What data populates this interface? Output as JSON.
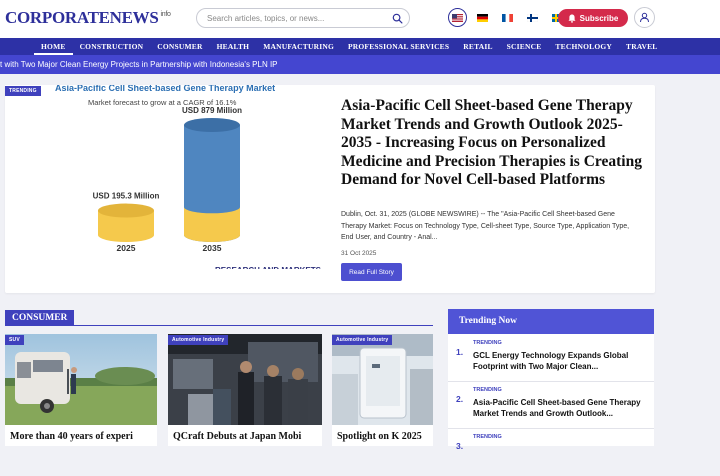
{
  "header": {
    "logo_main": "CORPORATENEWS",
    "logo_tld": "info",
    "search_placeholder": "Search articles, topics, or news...",
    "subscribe_label": "Subscribe",
    "flags": [
      "us",
      "de",
      "fr",
      "fi",
      "se"
    ]
  },
  "nav": {
    "items": [
      "HOME",
      "CONSTRUCTION",
      "CONSUMER",
      "HEALTH",
      "MANUFACTURING",
      "PROFESSIONAL SERVICES",
      "RETAIL",
      "SCIENCE",
      "TECHNOLOGY",
      "TRAVEL"
    ],
    "active": "HOME"
  },
  "ticker": {
    "text": "t with Two Major Clean Energy Projects in Partnership with Indonesia's PLN IP"
  },
  "hero": {
    "badge": "TRENDING",
    "chart_title": "Asia-Pacific Cell Sheet-based Gene Therapy Market",
    "chart_subtitle": "Market forecast to grow at a CAGR of 16.1%",
    "chart_brand": "RESEARCH AND MARKETS",
    "title": "Asia-Pacific Cell Sheet-based Gene Therapy Market Trends and Growth Outlook 2025-2035 - Increasing Focus on Personalized Medicine and Precision Therapies is Creating Demand for Novel Cell-based Platforms",
    "description": "Dublin, Oct. 31, 2025 (GLOBE NEWSWIRE) -- The \"Asia-Pacific Cell Sheet-based Gene Therapy Market: Focus on Technology Type, Cell-sheet Type, Source Type, Application Type, End User, and Country - Anal...",
    "date": "31 Oct 2025",
    "button_label": "Read Full Story"
  },
  "chart_data": {
    "type": "bar",
    "categories": [
      "2025",
      "2035"
    ],
    "values": [
      195.3,
      879
    ],
    "data_labels": [
      "USD 195.3 Million",
      "USD 879 Million"
    ],
    "title": "Asia-Pacific Cell Sheet-based Gene Therapy Market",
    "subtitle": "Market forecast to grow at a CAGR of 16.1%",
    "ylim": [
      0,
      879
    ],
    "colors": {
      "2025": "#f5c94c",
      "2035": "#4f86c0"
    }
  },
  "consumer": {
    "section_label": "CONSUMER",
    "cards": [
      {
        "tag": "SUV",
        "title": "More than 40 years of experi"
      },
      {
        "tag": "Automotive Industry",
        "title": "QCraft Debuts at Japan Mobi"
      },
      {
        "tag": "Automotive Industry",
        "title": "Spotlight on K 2025"
      }
    ]
  },
  "trending": {
    "heading": "Trending Now",
    "items": [
      {
        "num": "1.",
        "tag": "TRENDING",
        "text": "GCL Energy Technology Expands Global Footprint with Two Major Clean..."
      },
      {
        "num": "2.",
        "tag": "TRENDING",
        "text": "Asia-Pacific Cell Sheet-based Gene Therapy Market Trends and Growth Outlook..."
      },
      {
        "num": "3.",
        "tag": "TRENDING",
        "text": ""
      }
    ]
  },
  "colors": {
    "brand": "#2d2f9a",
    "nav_bg": "#2d31a6",
    "ticker_bg": "#4446d0",
    "subscribe": "#d42a4b",
    "accent": "#3f41bd"
  }
}
